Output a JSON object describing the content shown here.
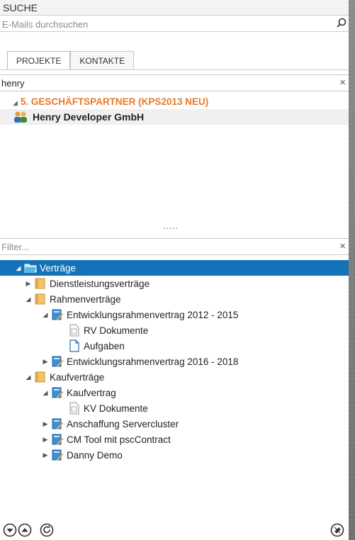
{
  "panel": {
    "title": "SUCHE"
  },
  "search": {
    "placeholder": "E-Mails durchsuchen"
  },
  "tabs": [
    {
      "label": "PROJEKTE"
    },
    {
      "label": "KONTAKTE"
    }
  ],
  "query": {
    "value": "henry"
  },
  "results": {
    "category": "5. GESCHÄFTSPARTNER (KPS2013 NEU)",
    "item": "Henry Developer GmbH"
  },
  "splitter": {
    "label": "....."
  },
  "filter": {
    "placeholder": "Filter..."
  },
  "tree": {
    "root": "Verträge",
    "items": [
      {
        "label": "Dienstleistungsverträge"
      },
      {
        "label": "Rahmenverträge"
      },
      {
        "label": "Entwicklungsrahmenvertrag 2012 - 2015"
      },
      {
        "label": "RV Dokumente"
      },
      {
        "label": "Aufgaben"
      },
      {
        "label": "Entwicklungsrahmenvertrag 2016 - 2018"
      },
      {
        "label": "Kaufverträge"
      },
      {
        "label": "Kaufvertrag"
      },
      {
        "label": "KV Dokumente"
      },
      {
        "label": "Anschaffung Servercluster"
      },
      {
        "label": "CM Tool mit pscContract"
      },
      {
        "label": "Danny Demo"
      }
    ]
  },
  "colors": {
    "accent": "#e8792a",
    "selection": "#1473b8"
  }
}
